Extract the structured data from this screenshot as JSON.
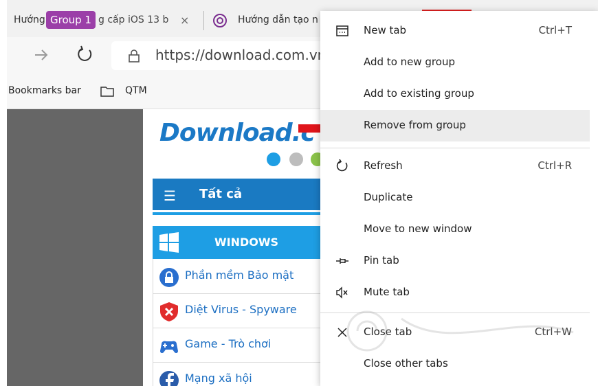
{
  "tabs": {
    "tab1_left_text": "Hướng",
    "group_label": "Group 1",
    "tab1_right_text": "g cấp iOS 13 b",
    "close_glyph": "×",
    "tab2_text": "Hướng dẫn tạo n"
  },
  "address_bar": {
    "url": "https://download.com.vn"
  },
  "bookmarks": {
    "bar_label": "Bookmarks bar",
    "folder": "QTM"
  },
  "page": {
    "logo": "Download.c",
    "category_title": "Tất cả",
    "windows_label": "WINDOWS",
    "list": [
      {
        "icon": "lock-icon",
        "label": "Phần mềm Bảo mật"
      },
      {
        "icon": "shield-icon",
        "label": "Diệt Virus - Spyware"
      },
      {
        "icon": "gamepad-icon",
        "label": "Game - Trò chơi"
      },
      {
        "icon": "facebook-icon",
        "label": "Mạng xã hội"
      }
    ],
    "colors": {
      "accent_blue": "#1a7ac2",
      "light_blue": "#1e9ee4",
      "group_purple": "#9b3fa8",
      "arrow_red": "#e0151b"
    }
  },
  "menu": {
    "items": [
      {
        "label": "New tab",
        "shortcut": "Ctrl+T",
        "icon": "new-tab-icon"
      },
      {
        "label": "Add to new group",
        "shortcut": "",
        "icon": ""
      },
      {
        "label": "Add to existing group",
        "shortcut": "",
        "icon": ""
      },
      {
        "label": "Remove from group",
        "shortcut": "",
        "icon": "",
        "highlighted": true
      },
      {
        "label": "Refresh",
        "shortcut": "Ctrl+R",
        "icon": "refresh-icon"
      },
      {
        "label": "Duplicate",
        "shortcut": "",
        "icon": ""
      },
      {
        "label": "Move to new window",
        "shortcut": "",
        "icon": ""
      },
      {
        "label": "Pin tab",
        "shortcut": "",
        "icon": "pin-icon"
      },
      {
        "label": "Mute tab",
        "shortcut": "",
        "icon": "mute-icon"
      },
      {
        "label": "Close tab",
        "shortcut": "Ctrl+W",
        "icon": "close-icon"
      },
      {
        "label": "Close other tabs",
        "shortcut": "",
        "icon": ""
      }
    ]
  }
}
